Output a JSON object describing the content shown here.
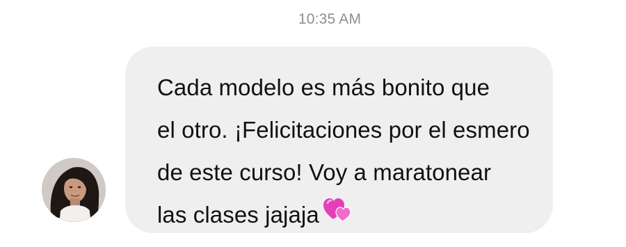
{
  "chat": {
    "timestamp": "10:35 AM",
    "message": {
      "lines": [
        "Cada modelo es más bonito que",
        "el otro. ¡Felicitaciones por el esmero",
        "de este curso! Voy a maratonear",
        "las clases jajaja"
      ],
      "emoji_icon": "two-hearts-icon"
    },
    "sender": {
      "avatar_icon": "profile-photo"
    }
  },
  "colors": {
    "bubble_background": "#efefef",
    "timestamp_text": "#8e8e8e",
    "message_text": "#111111",
    "emoji_pink": "#e23fb8"
  }
}
